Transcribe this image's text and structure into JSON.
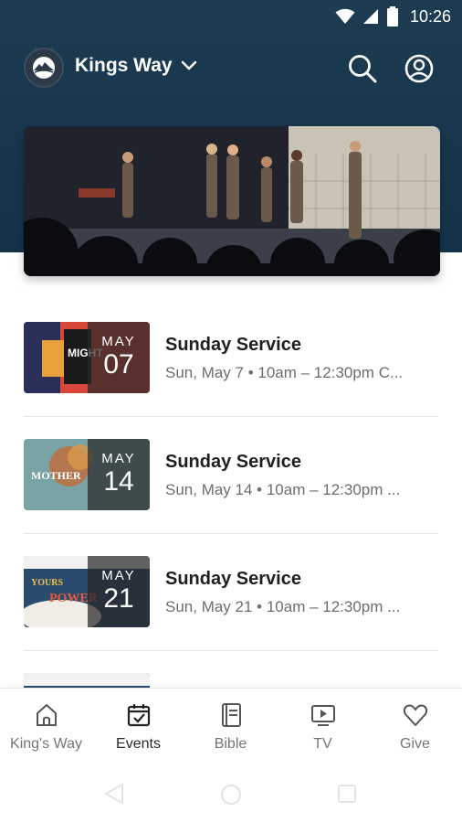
{
  "status": {
    "time": "10:26"
  },
  "header": {
    "church_name": "Kings Way",
    "search_icon": "search-icon",
    "account_icon": "account-icon"
  },
  "events": [
    {
      "title": "Sunday Service",
      "subtitle": "Sun, May 7 • 10am – 12:30pm C...",
      "month": "MAY",
      "day": "07",
      "thumb_art": "MIGHT"
    },
    {
      "title": "Sunday Service",
      "subtitle": "Sun, May 14 • 10am – 12:30pm ...",
      "month": "MAY",
      "day": "14",
      "thumb_art": "MOTHER"
    },
    {
      "title": "Sunday Service",
      "subtitle": "Sun, May 21 • 10am – 12:30pm ...",
      "month": "MAY",
      "day": "21",
      "thumb_art": "YOURS POWER"
    }
  ],
  "nav": [
    {
      "label": "King's Way",
      "icon": "home-icon"
    },
    {
      "label": "Events",
      "icon": "calendar-icon",
      "active": true
    },
    {
      "label": "Bible",
      "icon": "book-icon"
    },
    {
      "label": "TV",
      "icon": "tv-icon"
    },
    {
      "label": "Give",
      "icon": "heart-icon"
    }
  ],
  "colors": {
    "header_bg": "#17364d",
    "text_primary": "#1f1f1f",
    "text_secondary": "#6d6d6d"
  }
}
